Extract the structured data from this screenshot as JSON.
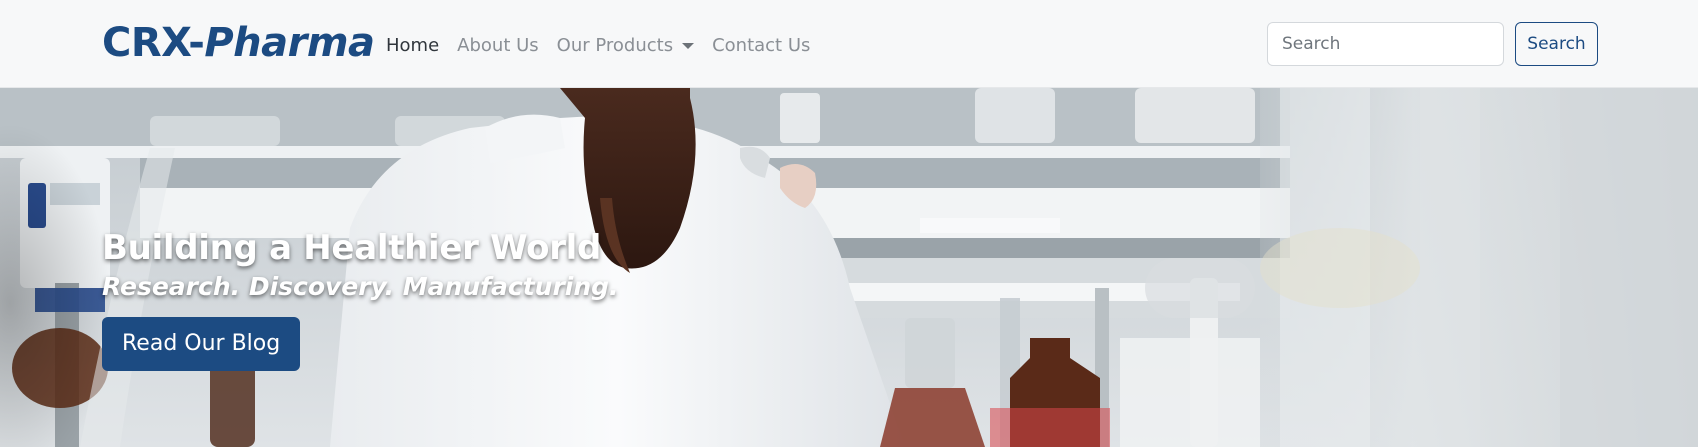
{
  "navbar": {
    "brand_part1": "CRX-",
    "brand_part2": "Pharma",
    "links": [
      {
        "label": "Home",
        "active": true
      },
      {
        "label": "About Us"
      },
      {
        "label": "Our Products",
        "dropdown": true
      },
      {
        "label": "Contact Us"
      }
    ],
    "search_placeholder": "Search",
    "search_button_label": "Search"
  },
  "hero": {
    "title": "Building a Healthier World",
    "subtitle": "Research. Discovery. Manufacturing.",
    "button_label": "Read Our Blog",
    "image_subject": "scientist-in-lab-coat-photo"
  },
  "colors": {
    "brand": "#1c4b82",
    "navbar_bg": "#f7f8f9",
    "nav_active": "#30363c",
    "nav_muted": "#8a8f95"
  }
}
